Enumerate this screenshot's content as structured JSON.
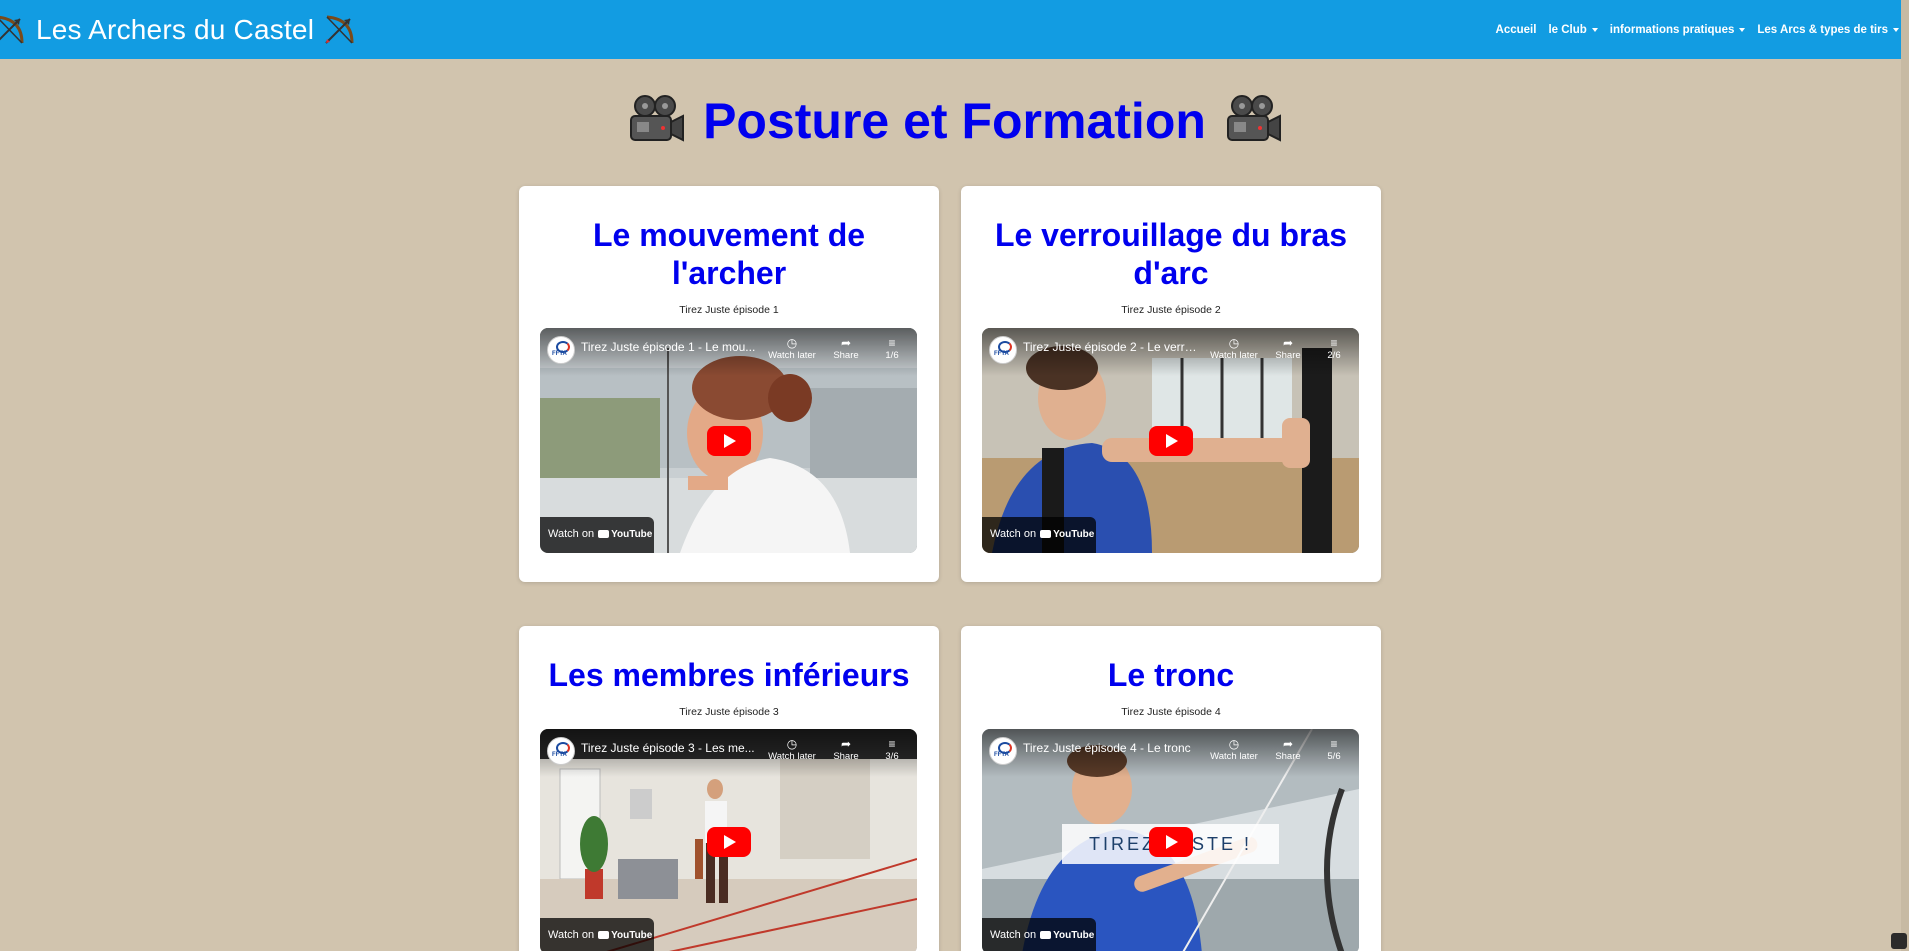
{
  "navbar": {
    "brand": "Les Archers du Castel",
    "brand_icon_left": "bow-arrow-icon",
    "brand_icon_right": "bow-arrow-icon",
    "links": [
      {
        "label": "Accueil",
        "dropdown": false
      },
      {
        "label": "le Club",
        "dropdown": true
      },
      {
        "label": "informations pratiques",
        "dropdown": true
      },
      {
        "label": "Les Arcs & types de tirs",
        "dropdown": true
      }
    ],
    "color": "#129ce2"
  },
  "page": {
    "title": "Posture et Formation",
    "title_icon": "movie-camera-icon",
    "background": "#d1c4ae",
    "title_color": "#0000ee"
  },
  "cards": [
    {
      "title": "Le mouvement de l'archer",
      "subtitle": "Tirez Juste épisode 1",
      "video": {
        "title": "Tirez Juste épisode 1 - Le mou...",
        "watch_later": "Watch later",
        "share": "Share",
        "playlist": "1/6",
        "watch_on": "Watch on",
        "youtube": "YouTube"
      }
    },
    {
      "title": "Le verrouillage du bras d'arc",
      "subtitle": "Tirez Juste épisode 2",
      "video": {
        "title": "Tirez Juste épisode 2 - Le verro...",
        "watch_later": "Watch later",
        "share": "Share",
        "playlist": "2/6",
        "watch_on": "Watch on",
        "youtube": "YouTube"
      }
    },
    {
      "title": "Les membres inférieurs",
      "subtitle": "Tirez Juste épisode 3",
      "video": {
        "title": "Tirez Juste épisode 3 - Les me...",
        "watch_later": "Watch later",
        "share": "Share",
        "playlist": "3/6",
        "watch_on": "Watch on",
        "youtube": "YouTube"
      }
    },
    {
      "title": "Le tronc",
      "subtitle": "Tirez Juste épisode 4",
      "video": {
        "title": "Tirez Juste épisode 4 - Le tronc",
        "watch_later": "Watch later",
        "share": "Share",
        "playlist": "5/6",
        "watch_on": "Watch on",
        "youtube": "YouTube",
        "overlay": "TIREZ JUSTE !"
      }
    }
  ]
}
